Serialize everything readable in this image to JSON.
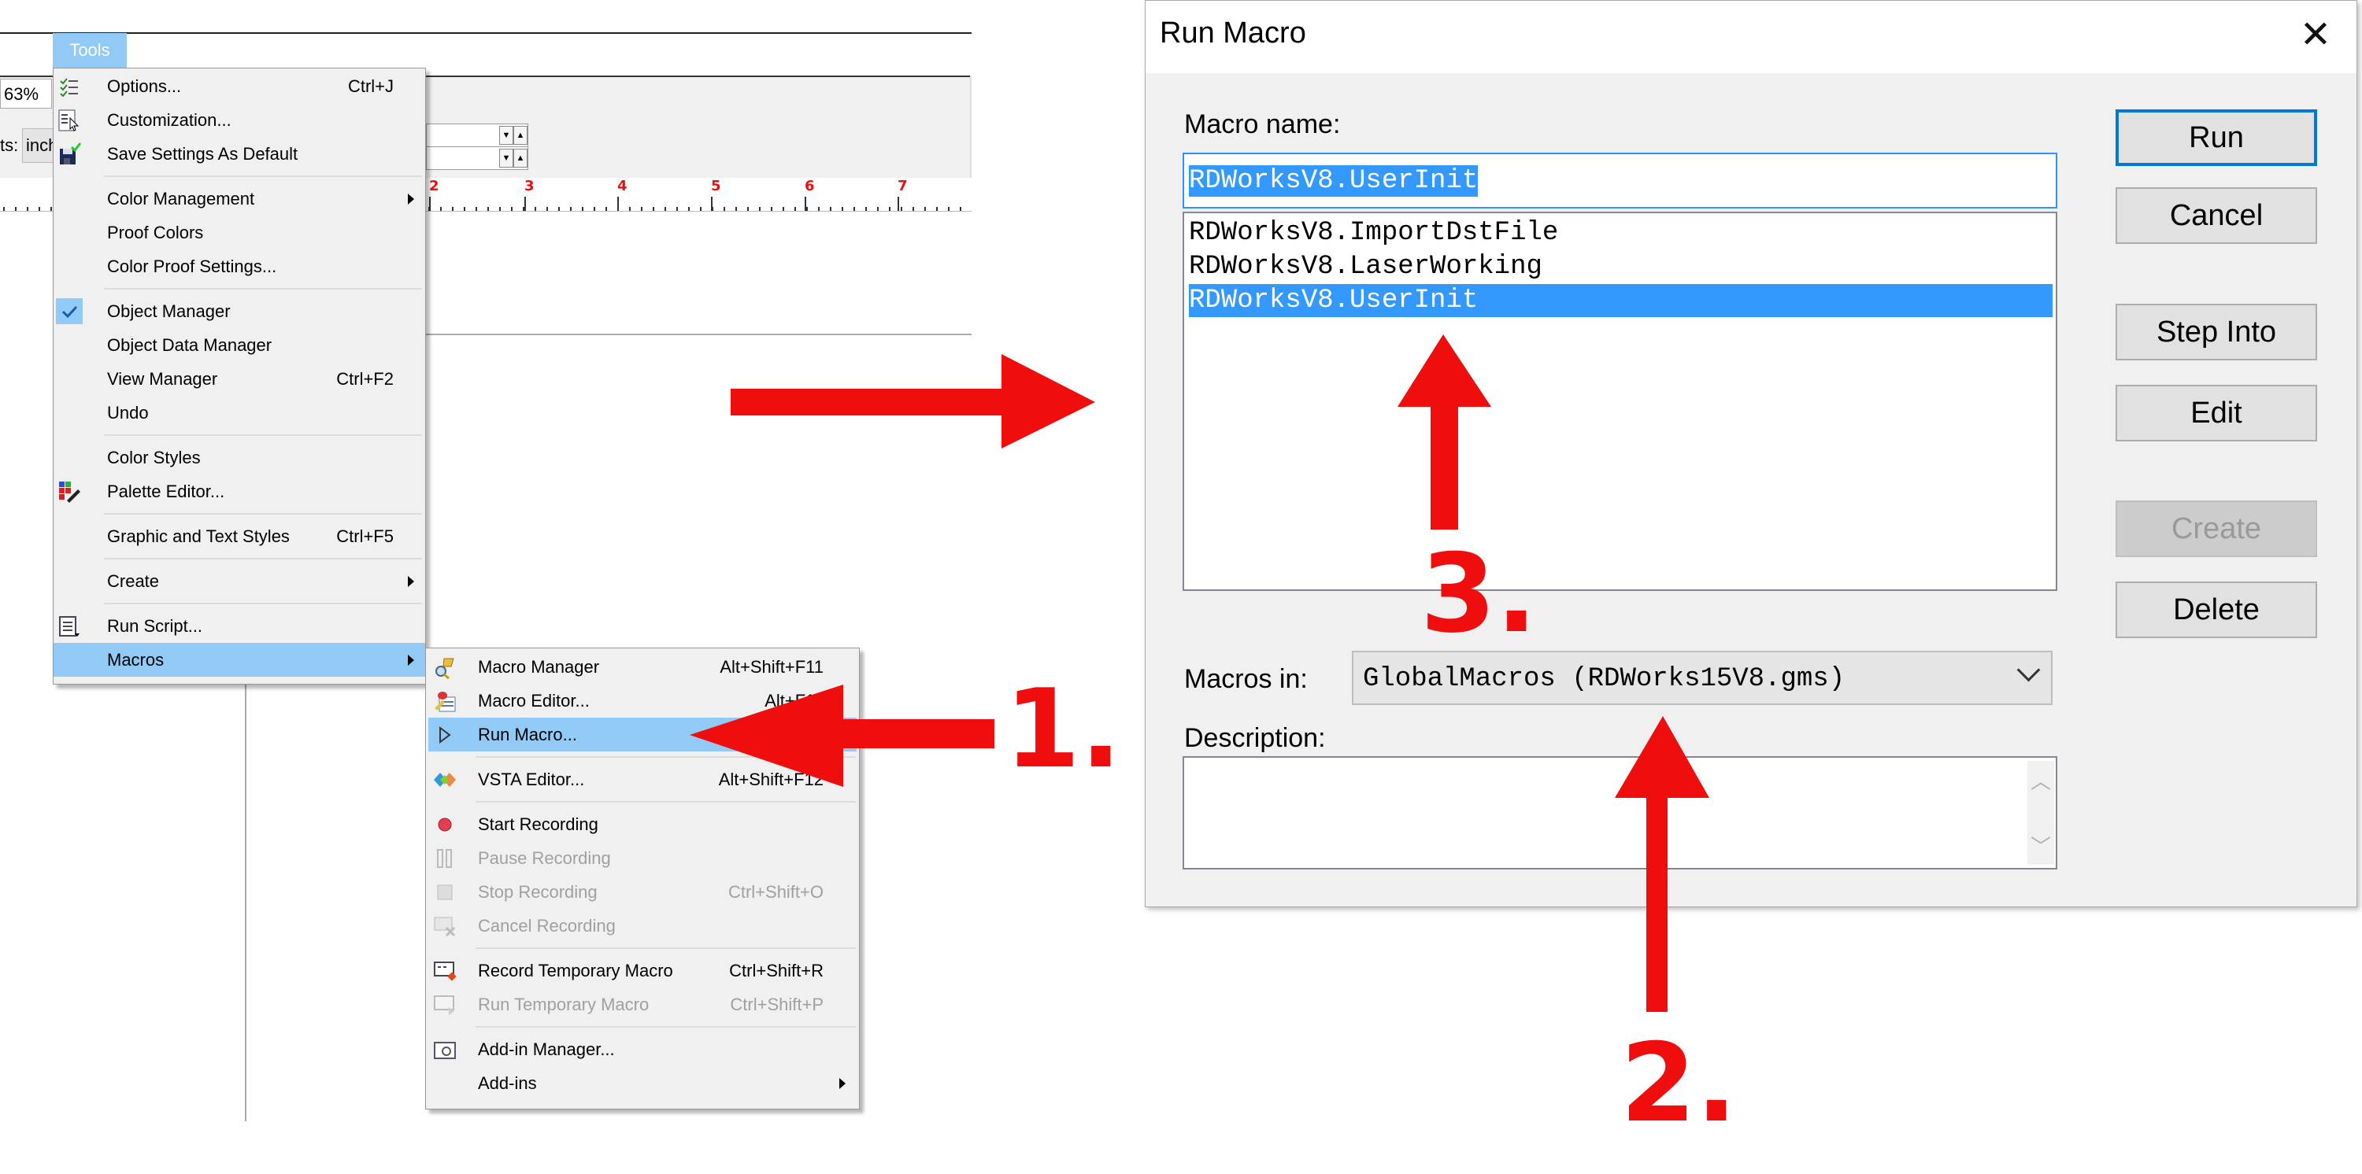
{
  "app": {
    "menubar_active": "Tools",
    "zoom_level": "63%",
    "units_label": "ts:",
    "units_value": "inch",
    "ruler_ticks": [
      "2",
      "3",
      "4",
      "5",
      "6",
      "7"
    ]
  },
  "tools_menu": {
    "items": [
      {
        "label": "Options...",
        "shortcut": "Ctrl+J",
        "icon": "options-checklist-icon"
      },
      {
        "label": "Customization...",
        "icon": "customization-icon"
      },
      {
        "label": "Save Settings As Default",
        "icon": "save-settings-icon"
      },
      {
        "separator": true
      },
      {
        "label": "Color Management",
        "submenu": true
      },
      {
        "label": "Proof Colors"
      },
      {
        "label": "Color Proof Settings..."
      },
      {
        "separator": true
      },
      {
        "label": "Object Manager",
        "checked": true,
        "icon": "checkmark-icon"
      },
      {
        "label": "Object Data Manager"
      },
      {
        "label": "View Manager",
        "shortcut": "Ctrl+F2"
      },
      {
        "label": "Undo"
      },
      {
        "separator": true
      },
      {
        "label": "Color Styles"
      },
      {
        "label": "Palette Editor...",
        "icon": "palette-editor-icon"
      },
      {
        "separator": true
      },
      {
        "label": "Graphic and Text Styles",
        "shortcut": "Ctrl+F5"
      },
      {
        "separator": true
      },
      {
        "label": "Create",
        "submenu": true
      },
      {
        "separator": true
      },
      {
        "label": "Run Script...",
        "icon": "run-script-icon"
      },
      {
        "label": "Macros",
        "submenu": true,
        "highlighted": true
      }
    ]
  },
  "macros_submenu": {
    "items": [
      {
        "label": "Macro Manager",
        "shortcut": "Alt+Shift+F11",
        "icon": "macro-manager-icon"
      },
      {
        "label": "Macro Editor...",
        "shortcut": "Alt+F11",
        "icon": "macro-editor-icon"
      },
      {
        "label": "Run Macro...",
        "icon": "play-triangle-icon",
        "highlighted": true
      },
      {
        "separator": true
      },
      {
        "label": "VSTA Editor...",
        "shortcut": "Alt+Shift+F12",
        "icon": "vsta-icon"
      },
      {
        "separator": true
      },
      {
        "label": "Start Recording",
        "icon": "record-dot-icon"
      },
      {
        "label": "Pause Recording",
        "icon": "pause-icon",
        "disabled": true
      },
      {
        "label": "Stop Recording",
        "shortcut": "Ctrl+Shift+O",
        "icon": "stop-icon",
        "disabled": true
      },
      {
        "label": "Cancel Recording",
        "icon": "cancel-recording-icon",
        "disabled": true
      },
      {
        "separator": true
      },
      {
        "label": "Record Temporary Macro",
        "shortcut": "Ctrl+Shift+R",
        "icon": "record-temporary-icon"
      },
      {
        "label": "Run Temporary Macro",
        "shortcut": "Ctrl+Shift+P",
        "icon": "run-temporary-icon",
        "disabled": true
      },
      {
        "separator": true
      },
      {
        "label": "Add-in Manager...",
        "icon": "addin-manager-icon"
      },
      {
        "label": "Add-ins",
        "submenu": true
      }
    ]
  },
  "dialog": {
    "title": "Run Macro",
    "macro_name_label": "Macro name:",
    "macro_name_value": "RDWorksV8.UserInit",
    "macros": [
      "RDWorksV8.ImportDstFile",
      "RDWorksV8.LaserWorking",
      "RDWorksV8.UserInit"
    ],
    "selected_macro_index": 2,
    "macros_in_label": "Macros in:",
    "macros_in_value": "GlobalMacros (RDWorks15V8.gms)",
    "description_label": "Description:",
    "description_value": "",
    "buttons": {
      "run": "Run",
      "cancel": "Cancel",
      "step_into": "Step Into",
      "edit": "Edit",
      "create": "Create",
      "delete": "Delete"
    },
    "create_disabled": true
  },
  "annotations": {
    "color": "#f00d0d",
    "steps": [
      "1.",
      "2.",
      "3."
    ]
  },
  "colors": {
    "menu_highlight": "#91c9f7",
    "selection": "#3399ff",
    "default_button_border": "#0078d7"
  }
}
